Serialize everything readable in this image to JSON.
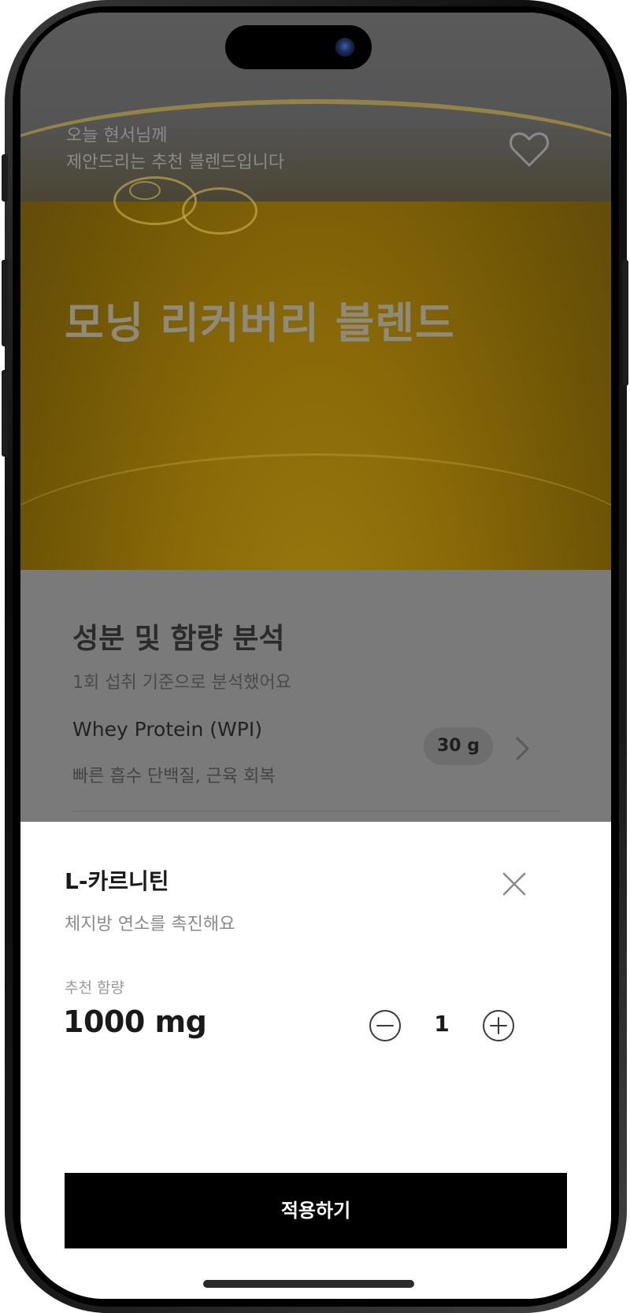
{
  "hero": {
    "subtitle_line1": "오늘 현서님께",
    "subtitle_line2": "제안드리는 추천 블렌드입니다",
    "title": "모닝 리커버리 블렌드",
    "favorite_icon": "heart-outline-icon"
  },
  "analysis": {
    "title": "성분 및 함량 분석",
    "subtitle": "1회 섭취 기준으로 분석했어요",
    "ingredients": [
      {
        "name": "Whey Protein (WPI)",
        "description": "빠른 흡수 단백질, 근육 회복",
        "amount": "30 g"
      }
    ]
  },
  "sheet": {
    "title": "L-카르니틴",
    "description": "체지방 연소를 촉진해요",
    "recommended_label": "추천 함량",
    "recommended_value": "1000 mg",
    "quantity": "1",
    "apply_label": "적용하기"
  },
  "colors": {
    "primary_button": "#000000",
    "sheet_background": "#ffffff",
    "overlay_dim": "#7a7a7a"
  }
}
